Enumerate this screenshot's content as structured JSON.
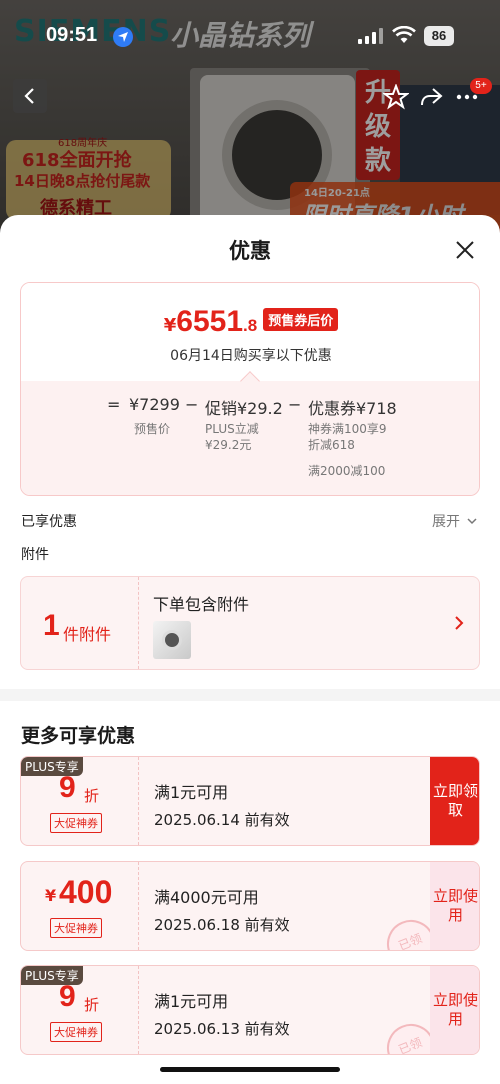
{
  "status_bar": {
    "time": "09:51",
    "battery": "86"
  },
  "banner": {
    "brand": "SIEMENS",
    "series": "小晶钻系列",
    "promo_anniversary": "618周年庆",
    "promo_line1": "618全面开抢",
    "promo_line2": "14日晚8点抢付尾款",
    "promo_line3": "德系精工",
    "side_tag": "升级款",
    "flash_time": "14日20-21点",
    "flash_text": "限时直降1小时",
    "cart_badge": "5+"
  },
  "sheet": {
    "title": "优惠",
    "summary": {
      "currency": "¥",
      "price_int": "6551",
      "price_dec": ".8",
      "price_tag": "预售券后价",
      "date_note": "06月14日购买享以下优惠",
      "equals": "=",
      "minus": "−",
      "base_price": "¥7299",
      "base_label": "预售价",
      "promo_price": "促销¥29.2",
      "promo_label_1": "PLUS立减",
      "promo_label_2": "¥29.2元",
      "coupon_price": "优惠券¥718",
      "coupon_label_1": "神券满100享9",
      "coupon_label_2": "折减618",
      "coupon_label_3": "满2000减100"
    },
    "enjoyed_label": "已享优惠",
    "expand_label": "展开",
    "accessory_label": "附件",
    "accessory": {
      "count": "1",
      "count_label": "件附件",
      "title": "下单包含附件"
    },
    "more_title": "更多可享优惠",
    "coupons": [
      {
        "plus_tag": "PLUS专享",
        "discount": "9",
        "discount_unit": "折",
        "type": "大促神券",
        "condition": "满1元可用",
        "valid": "2025.06.14 前有效",
        "action": "立即领取"
      },
      {
        "currency": "¥",
        "amount": "400",
        "type": "大促神券",
        "condition": "满4000元可用",
        "valid": "2025.06.18 前有效",
        "action": "立即使用",
        "stamp": "已领"
      },
      {
        "plus_tag": "PLUS专享",
        "discount": "9",
        "discount_unit": "折",
        "type": "大促神券",
        "condition": "满1元可用",
        "valid": "2025.06.13 前有效",
        "action": "立即使用",
        "stamp": "已领"
      }
    ]
  },
  "colors": {
    "accent": "#e2231a",
    "pale_pink": "#fdf3f3",
    "plus_tag": "#5a4a3f"
  }
}
